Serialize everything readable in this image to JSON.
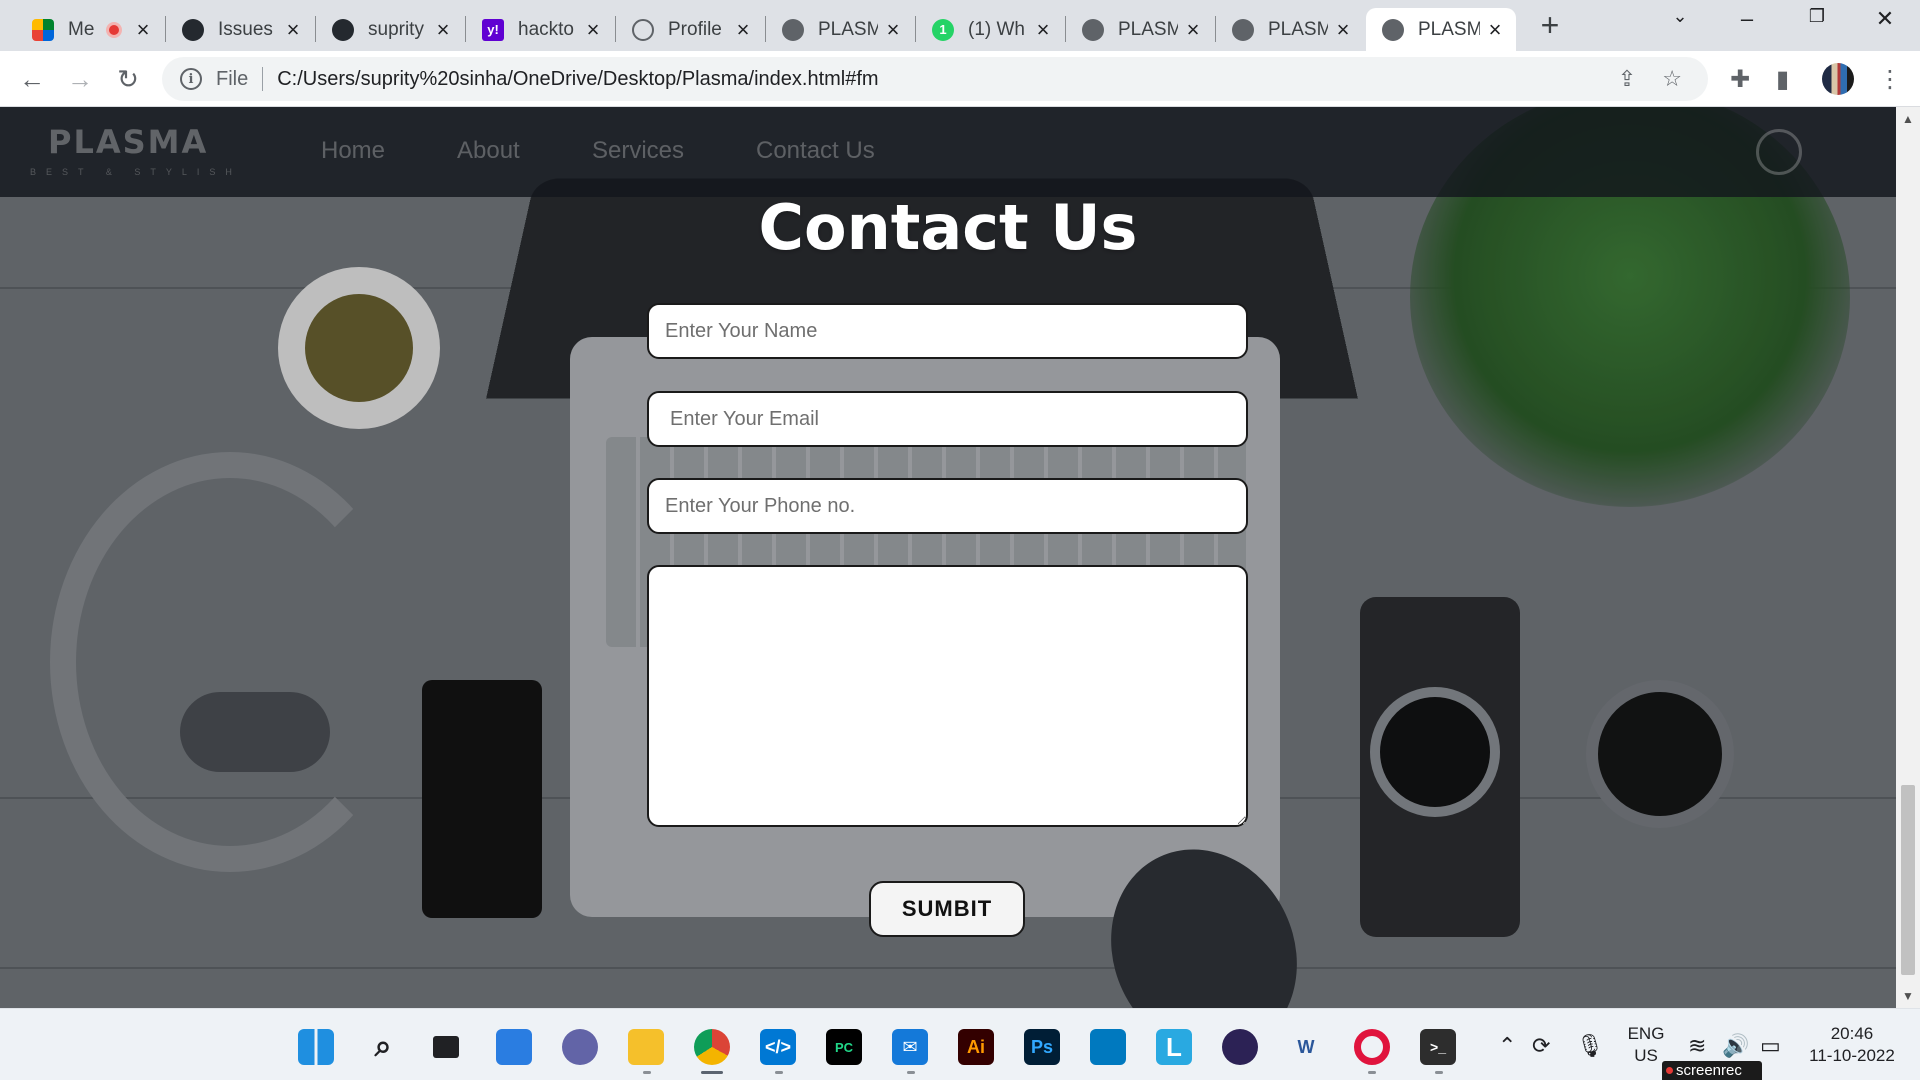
{
  "browser": {
    "tabs": [
      {
        "title": "Me",
        "favicon": "google-meet-icon",
        "recording": true
      },
      {
        "title": "Issues",
        "favicon": "github-icon"
      },
      {
        "title": "suprity",
        "favicon": "github-icon"
      },
      {
        "title": "hackto",
        "favicon": "yahoo-icon"
      },
      {
        "title": "Profile",
        "favicon": "globe-icon"
      },
      {
        "title": "PLASM",
        "favicon": "globe-icon"
      },
      {
        "title": "(1) Wh",
        "favicon": "whatsapp-icon"
      },
      {
        "title": "PLASM",
        "favicon": "globe-icon"
      },
      {
        "title": "PLASM",
        "favicon": "globe-icon"
      },
      {
        "title": "PLASM",
        "favicon": "globe-icon",
        "active": true
      }
    ],
    "scheme_label": "File",
    "url": "C:/Users/suprity%20sinha/OneDrive/Desktop/Plasma/index.html#fm"
  },
  "site": {
    "logo": "PLASMA",
    "tagline": "BEST & STYLISH",
    "nav": [
      "Home",
      "About",
      "Services",
      "Contact Us"
    ]
  },
  "contact": {
    "title": "Contact Us",
    "name_placeholder": "Enter Your Name",
    "email_placeholder": "Enter Your Email",
    "phone_placeholder": "Enter Your Phone no.",
    "message_value": "",
    "submit_label": "SUMBIT"
  },
  "taskbar": {
    "apps": [
      "windows-start-icon",
      "search-icon",
      "task-view-icon",
      "widgets-icon",
      "teams-chat-icon",
      "file-explorer-icon",
      "chrome-icon",
      "vscode-icon",
      "pycharm-icon",
      "mail-icon",
      "illustrator-icon",
      "photoshop-icon",
      "trello-icon",
      "l-app-icon",
      "eclipse-icon",
      "word-icon",
      "opera-icon",
      "terminal-icon"
    ],
    "language_line1": "ENG",
    "language_line2": "US",
    "time": "20:46",
    "date": "11-10-2022",
    "recorder_label": "screenrec"
  },
  "colors": {
    "tabstrip_bg": "#dee1e6",
    "nav_overlay": "#12161c",
    "field_border": "#1a1a1a"
  }
}
